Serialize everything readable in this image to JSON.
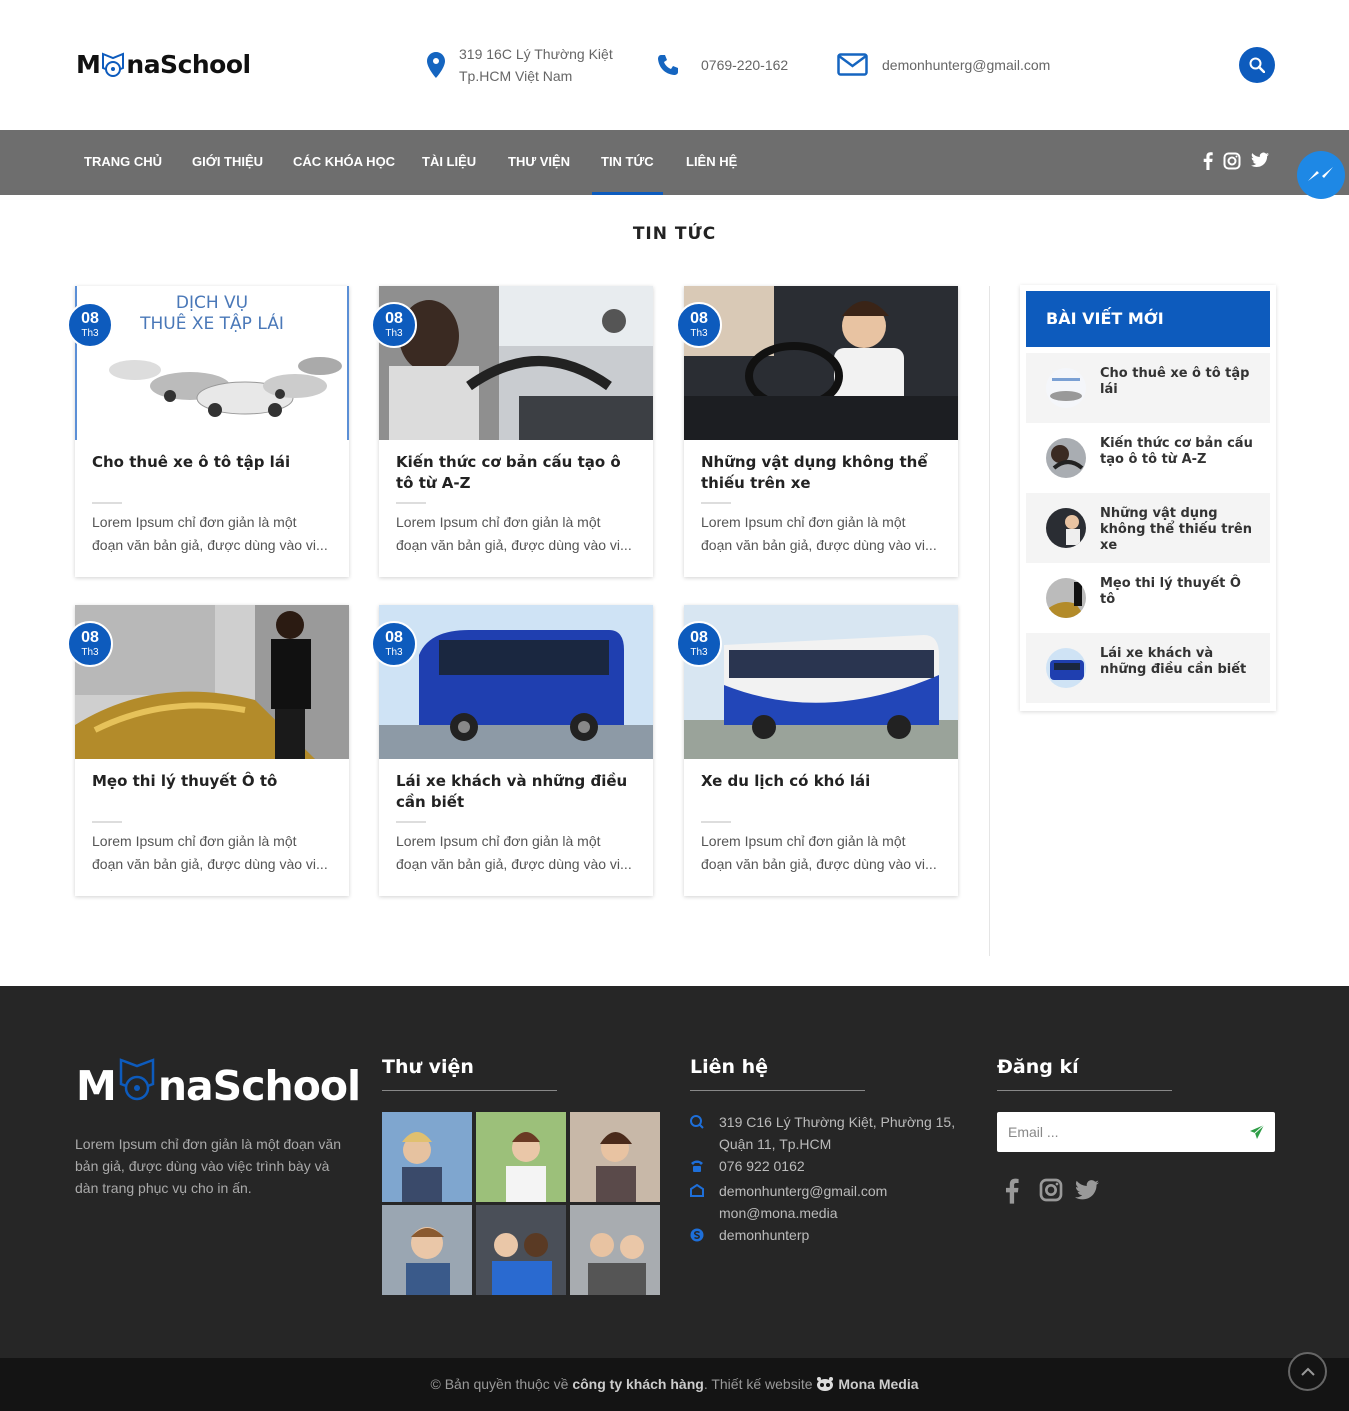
{
  "header": {
    "logo_pre": "M",
    "logo_post": "naSchool",
    "address_line1": "319 16C Lý Thường Kiệt",
    "address_line2": "Tp.HCM Việt Nam",
    "phone": "0769-220-162",
    "email": "demonhunterg@gmail.com"
  },
  "nav": {
    "items": [
      "Trang chủ",
      "Giới thiệu",
      "Các khóa học",
      "Tài liệu",
      "Thư viện",
      "Tin tức",
      "Liên hệ"
    ],
    "active_index": 5
  },
  "page": {
    "title": "TIN TỨC"
  },
  "posts": [
    {
      "day": "08",
      "month": "Th3",
      "title": "Cho thuê xe ô tô tập lái",
      "excerpt_l1": "Lorem Ipsum chỉ đơn giản là một",
      "excerpt_l2": "đoạn văn bản giả, được dùng vào vi...",
      "thumb_caption_1": "DỊCH VỤ",
      "thumb_caption_2": "THUÊ XE TẬP LÁI"
    },
    {
      "day": "08",
      "month": "Th3",
      "title": "Kiến thức cơ bản cấu tạo ô tô từ A-Z",
      "excerpt_l1": "Lorem Ipsum chỉ đơn giản là một",
      "excerpt_l2": "đoạn văn bản giả, được dùng vào vi..."
    },
    {
      "day": "08",
      "month": "Th3",
      "title": "Những vật dụng không thể thiếu trên xe",
      "excerpt_l1": "Lorem Ipsum chỉ đơn giản là một",
      "excerpt_l2": "đoạn văn bản giả, được dùng vào vi..."
    },
    {
      "day": "08",
      "month": "Th3",
      "title": "Mẹo thi lý thuyết Ô tô",
      "excerpt_l1": "Lorem Ipsum chỉ đơn giản là một",
      "excerpt_l2": "đoạn văn bản giả, được dùng vào vi..."
    },
    {
      "day": "08",
      "month": "Th3",
      "title": "Lái xe khách và những điều cần biết",
      "excerpt_l1": "Lorem Ipsum chỉ đơn giản là một",
      "excerpt_l2": "đoạn văn bản giả, được dùng vào vi..."
    },
    {
      "day": "08",
      "month": "Th3",
      "title": "Xe du lịch có khó lái",
      "excerpt_l1": "Lorem Ipsum chỉ đơn giản là một",
      "excerpt_l2": "đoạn văn bản giả, được dùng vào vi..."
    }
  ],
  "sidebar": {
    "title": "BÀI VIẾT MỚI",
    "items": [
      "Cho thuê xe ô tô tập lái",
      "Kiến thức cơ bản cấu tạo ô tô từ A-Z",
      "Những vật dụng không thể thiếu trên xe",
      "Mẹo thi lý thuyết Ô tô",
      "Lái xe khách và những điều cần biết"
    ]
  },
  "footer": {
    "logo_pre": "M",
    "logo_post": "naSchool",
    "description": "Lorem Ipsum chỉ đơn giản là một đoạn văn bản giả, được dùng vào việc trình bày và dàn trang phục vụ cho in ấn.",
    "gallery_title": "Thư viện",
    "contact_title": "Liên hệ",
    "contact": {
      "address_l1": "319 C16 Lý Thường Kiệt, Phường 15,",
      "address_l2": "Quận 11, Tp.HCM",
      "phone": "076 922 0162",
      "email1": "demonhunterg@gmail.com",
      "email2": "mon@mona.media",
      "skype": "demonhunterp"
    },
    "subscribe_title": "Đăng kí",
    "email_placeholder": "Email ...",
    "copyright_pre": "© Bản quyền thuộc về ",
    "copyright_company": "công ty khách hàng",
    "copyright_mid": ". Thiết kế website ",
    "copyright_brand": "Mona Media"
  },
  "colors": {
    "brand_blue": "#0d5bbd",
    "nav_gray": "#6e6e6e",
    "footer_dark": "#262626",
    "bottom_bar": "#141414"
  },
  "icons": [
    "map-pin-icon",
    "phone-icon",
    "mail-icon",
    "search-icon",
    "facebook-icon",
    "instagram-icon",
    "twitter-icon",
    "messenger-icon",
    "send-icon",
    "arrow-up-icon"
  ]
}
